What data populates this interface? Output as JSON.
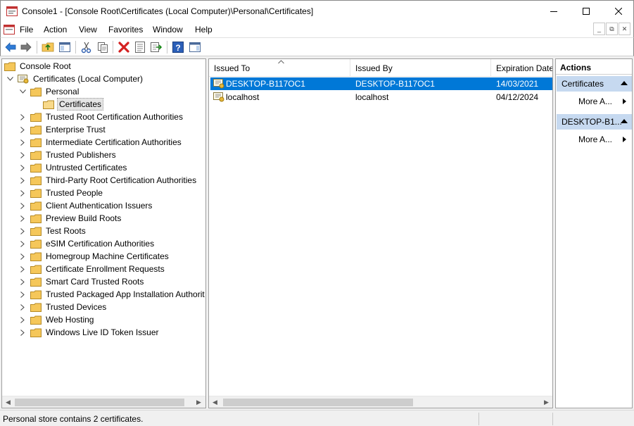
{
  "window": {
    "title": "Console1 - [Console Root\\Certificates (Local Computer)\\Personal\\Certificates]",
    "minimize_glyph": "—",
    "maximize_glyph": "☐",
    "close_glyph": "✕"
  },
  "menu": {
    "items": [
      "File",
      "Action",
      "View",
      "Favorites",
      "Window",
      "Help"
    ],
    "mdi_minimize": "_",
    "mdi_restore": "⧉",
    "mdi_close": "✕"
  },
  "toolbar": {
    "icons": [
      "back-arrow-icon",
      "forward-arrow-icon",
      "up-folder-icon",
      "show-hide-tree-icon",
      "cut-icon",
      "copy-icon",
      "delete-icon",
      "properties-icon",
      "export-icon",
      "help-icon",
      "show-hide-action-pane-icon"
    ]
  },
  "tree": {
    "root": "Console Root",
    "computer": "Certificates (Local Computer)",
    "personal": "Personal",
    "certificates": "Certificates",
    "stores": [
      "Trusted Root Certification Authorities",
      "Enterprise Trust",
      "Intermediate Certification Authorities",
      "Trusted Publishers",
      "Untrusted Certificates",
      "Third-Party Root Certification Authorities",
      "Trusted People",
      "Client Authentication Issuers",
      "Preview Build Roots",
      "Test Roots",
      "eSIM Certification Authorities",
      "Homegroup Machine Certificates",
      "Certificate Enrollment Requests",
      "Smart Card Trusted Roots",
      "Trusted Packaged App Installation Authorit",
      "Trusted Devices",
      "Web Hosting",
      "Windows Live ID Token Issuer"
    ]
  },
  "list": {
    "columns": [
      "Issued To",
      "Issued By",
      "Expiration Date"
    ],
    "rows": [
      {
        "issued_to": "DESKTOP-B117OC1",
        "issued_by": "DESKTOP-B117OC1",
        "expiration": "14/03/2021",
        "selected": true
      },
      {
        "issued_to": "localhost",
        "issued_by": "localhost",
        "expiration": "04/12/2024",
        "selected": false
      }
    ]
  },
  "actions": {
    "title": "Actions",
    "sections": [
      {
        "header": "Certificates",
        "item": "More A..."
      },
      {
        "header": "DESKTOP-B1...",
        "item": "More A..."
      }
    ]
  },
  "status": {
    "text": "Personal store contains 2 certificates."
  },
  "colors": {
    "selection": "#0078d7",
    "action_header": "#c6d9f0",
    "folder": "#f5c75a"
  }
}
